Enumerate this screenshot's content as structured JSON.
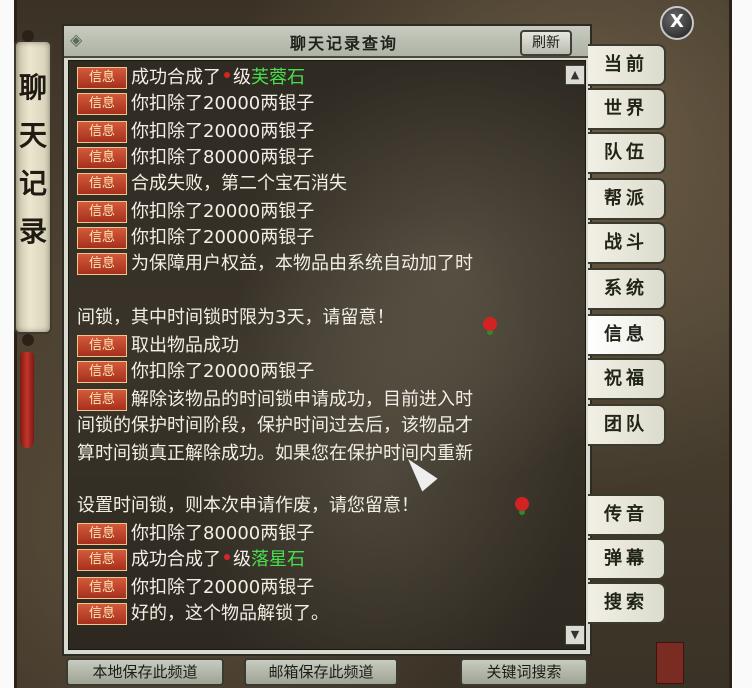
{
  "window": {
    "title": "聊天记录查询",
    "side_label": "聊天记录",
    "refresh_label": "刷新",
    "close_label": "X"
  },
  "badge_label": "信息",
  "messages": [
    {
      "pre": "成功合成了",
      "level_marker": true,
      "mid": "级",
      "gem": "芙蓉石",
      "post": ""
    },
    {
      "pre": "你扣除了20000两银子"
    },
    {
      "pre": "你扣除了20000两银子"
    },
    {
      "pre": "你扣除了80000两银子"
    },
    {
      "pre": "合成失败，第二个宝石消失"
    },
    {
      "pre": "你扣除了20000两银子"
    },
    {
      "pre": "你扣除了20000两银子"
    },
    {
      "pre": "为保障用户权益，本物品由系统自动加了时"
    },
    {
      "cont": "间锁，其中时间锁时限为3天，请留意！"
    },
    {
      "pre": "取出物品成功"
    },
    {
      "pre": "你扣除了20000两银子"
    },
    {
      "pre": "解除该物品的时间锁申请成功，目前进入时"
    },
    {
      "cont": "间锁的保护时间阶段，保护时间过去后，该物品才"
    },
    {
      "cont": "算时间锁真正解除成功。如果您在保护时间内重新"
    },
    {
      "cont": "设置时间锁，则本次申请作废，请您留意！"
    },
    {
      "pre": "你扣除了80000两银子"
    },
    {
      "pre": "成功合成了",
      "level_marker": true,
      "mid": "级",
      "gem": "落星石",
      "post": ""
    },
    {
      "pre": "你扣除了20000两银子"
    },
    {
      "pre": "好的，这个物品解锁了。"
    }
  ],
  "channel_tabs": [
    "当前",
    "世界",
    "队伍",
    "帮派",
    "战斗",
    "系统",
    "信息",
    "祝福",
    "团队",
    "传音",
    "弹幕",
    "搜索"
  ],
  "active_tab": "信息",
  "bottom_buttons": [
    "本地保存此频道",
    "邮箱保存此频道",
    "关键词搜索"
  ],
  "colors": {
    "gem_name": "#47e04d",
    "badge": "#c0432a",
    "text": "#f2efe6"
  }
}
